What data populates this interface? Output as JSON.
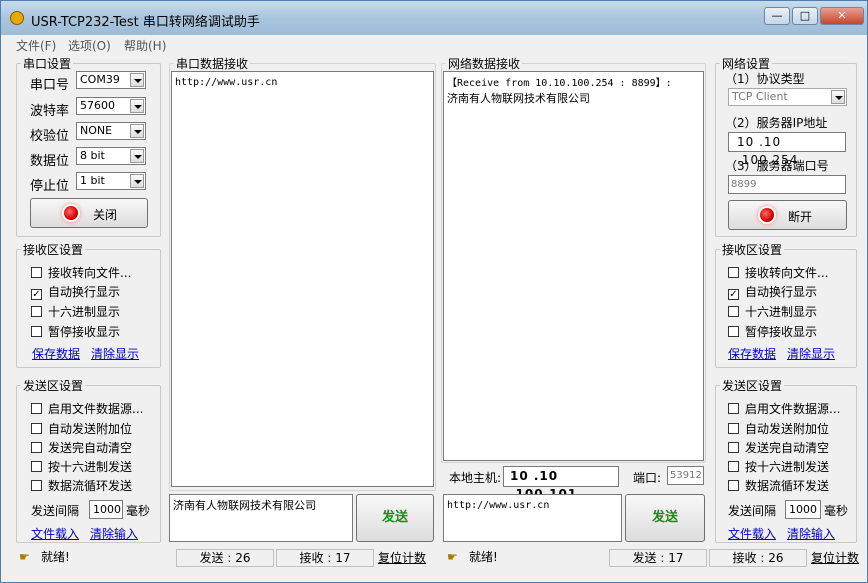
{
  "window": {
    "title": "USR-TCP232-Test 串口转网络调试助手",
    "min": "—",
    "max": "□",
    "close": "✕"
  },
  "menu": {
    "file": "文件(F)",
    "options": "选项(O)",
    "help": "帮助(H)"
  },
  "serial": {
    "legend": "串口设置",
    "port_label": "串口号",
    "port": "COM39",
    "baud_label": "波特率",
    "baud": "57600",
    "parity_label": "校验位",
    "parity": "NONE",
    "data_label": "数据位",
    "data": "8 bit",
    "stop_label": "停止位",
    "stop": "1 bit",
    "button": "关闭"
  },
  "recv_left": {
    "legend": "接收区设置",
    "opt1": "接收转向文件...",
    "opt2": "自动换行显示",
    "opt3": "十六进制显示",
    "opt4": "暂停接收显示",
    "save": "保存数据",
    "clear": "清除显示"
  },
  "send_left": {
    "legend": "发送区设置",
    "opt1": "启用文件数据源...",
    "opt2": "自动发送附加位",
    "opt3": "发送完自动清空",
    "opt4": "按十六进制发送",
    "opt5": "数据流循环发送",
    "interval_label": "发送间隔",
    "interval": "1000",
    "ms": "毫秒",
    "load": "文件载入",
    "clear": "清除输入"
  },
  "serial_recv": {
    "legend": "串口数据接收",
    "content": "http://www.usr.cn"
  },
  "net_recv": {
    "legend": "网络数据接收",
    "line1": "【Receive from 10.10.100.254 : 8899】:",
    "line2": "济南有人物联网技术有限公司"
  },
  "local": {
    "host_label": "本地主机:",
    "host": "10 .10 .100.101",
    "port_label": "端口:",
    "port": "53912"
  },
  "serial_send": {
    "content": "济南有人物联网技术有限公司",
    "button": "发送"
  },
  "net_send": {
    "content": "http://www.usr.cn",
    "button": "发送"
  },
  "network": {
    "legend": "网络设置",
    "proto_label": "（1）协议类型",
    "proto": "TCP Client",
    "ip_label": "（2）服务器IP地址",
    "ip": "10 .10 .100.254",
    "port_label": "（3）服务器端口号",
    "port": "8899",
    "button": "断开"
  },
  "recv_right": {
    "legend": "接收区设置",
    "opt1": "接收转向文件...",
    "opt2": "自动换行显示",
    "opt3": "十六进制显示",
    "opt4": "暂停接收显示",
    "save": "保存数据",
    "clear": "清除显示"
  },
  "send_right": {
    "legend": "发送区设置",
    "opt1": "启用文件数据源...",
    "opt2": "自动发送附加位",
    "opt3": "发送完自动清空",
    "opt4": "按十六进制发送",
    "opt5": "数据流循环发送",
    "interval_label": "发送间隔",
    "interval": "1000",
    "ms": "毫秒",
    "load": "文件载入",
    "clear": "清除输入"
  },
  "status_left": {
    "ready": "就绪!",
    "sent": "发送 : 26",
    "recv": "接收 : 17",
    "reset": "复位计数"
  },
  "status_right": {
    "ready": "就绪!",
    "sent": "发送 : 17",
    "recv": "接收 : 26",
    "reset": "复位计数"
  },
  "checkmark": "✓"
}
